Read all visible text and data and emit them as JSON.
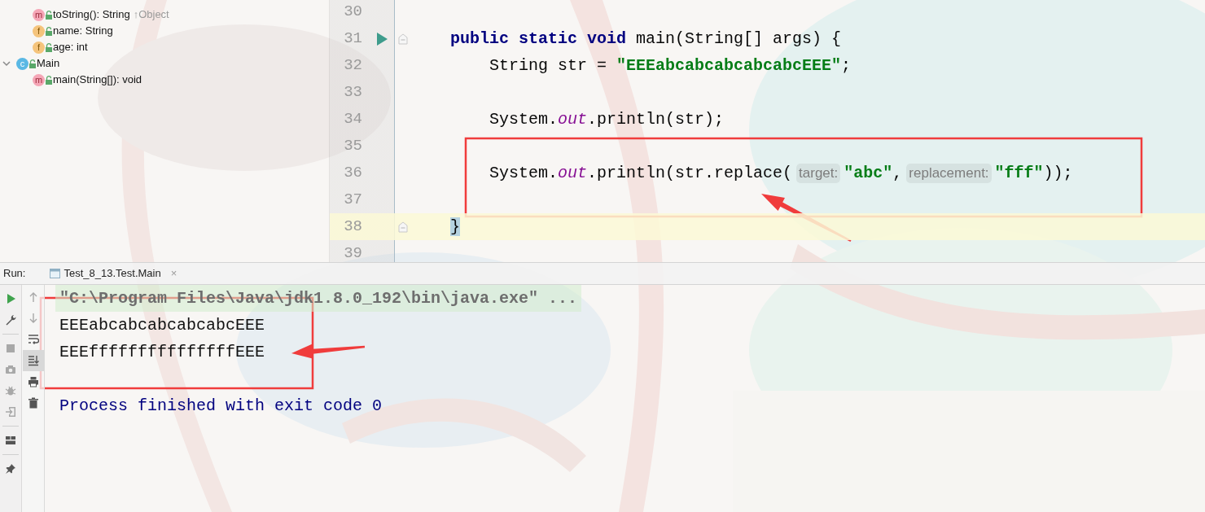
{
  "structure": {
    "tree": [
      {
        "children": [
          {
            "kind": "method",
            "icon": "m",
            "text": "toString(): String",
            "suffix": "↑Object"
          },
          {
            "kind": "field",
            "icon": "f",
            "text": "name: String"
          },
          {
            "kind": "field",
            "icon": "f",
            "text": "age: int"
          }
        ]
      },
      {
        "kind": "class",
        "icon": "c",
        "text": "Main",
        "expanded": true,
        "children": [
          {
            "kind": "method",
            "icon": "m",
            "text": "main(String[]): void"
          }
        ]
      }
    ]
  },
  "editor": {
    "lines": [
      {
        "number": "30"
      },
      {
        "number": "31",
        "kind": "member",
        "run_icon": true,
        "fold": true,
        "segments": [
          {
            "kind": "code",
            "parts": [
              {
                "kind": "keyword",
                "text": "public static void"
              },
              {
                "kind": "plain",
                "text": " main(String[] args) {"
              }
            ]
          }
        ]
      },
      {
        "number": "32",
        "kind": "statement",
        "segments": [
          {
            "kind": "code",
            "parts": [
              {
                "kind": "plain",
                "text": "String str = "
              },
              {
                "kind": "string",
                "text": "\"EEEabcabcabcabcabcEEE\""
              },
              {
                "kind": "plain",
                "text": ";"
              }
            ]
          }
        ]
      },
      {
        "number": "33"
      },
      {
        "number": "34",
        "kind": "statement",
        "segments": [
          {
            "kind": "code",
            "parts": [
              {
                "kind": "plain",
                "text": "System."
              },
              {
                "kind": "field",
                "text": "out"
              },
              {
                "kind": "plain",
                "text": ".println(str);"
              }
            ]
          }
        ]
      },
      {
        "number": "35"
      },
      {
        "number": "36",
        "kind": "statement",
        "segments": [
          {
            "kind": "code",
            "parts": [
              {
                "kind": "plain",
                "text": "System."
              },
              {
                "kind": "field",
                "text": "out"
              },
              {
                "kind": "plain",
                "text": ".println(str.replace("
              }
            ]
          },
          {
            "kind": "hint",
            "text": "target:"
          },
          {
            "kind": "code",
            "parts": [
              {
                "kind": "string",
                "text": "\"abc\""
              },
              {
                "kind": "plain",
                "text": ","
              }
            ]
          },
          {
            "kind": "hint",
            "text": "replacement:"
          },
          {
            "kind": "code",
            "parts": [
              {
                "kind": "string",
                "text": "\"fff\""
              },
              {
                "kind": "plain",
                "text": "));"
              }
            ]
          }
        ]
      },
      {
        "number": "37"
      },
      {
        "number": "38",
        "kind": "member",
        "current": true,
        "fold": true,
        "segments": [
          {
            "kind": "code",
            "parts": [
              {
                "kind": "brace",
                "text": "}"
              }
            ]
          }
        ]
      },
      {
        "number": "39"
      }
    ]
  },
  "run_panel": {
    "label": "Run:",
    "tabs": [
      {
        "title": "Test_8_13.Test.Main",
        "close": "×"
      }
    ],
    "run_toolbar": [
      {
        "kind": "run",
        "disabled": false
      },
      {
        "kind": "wrench",
        "disabled": false
      },
      {
        "kind": "divider"
      },
      {
        "kind": "stop",
        "disabled": true
      },
      {
        "kind": "camera",
        "disabled": true
      },
      {
        "kind": "bug",
        "disabled": true
      },
      {
        "kind": "exit",
        "disabled": true
      },
      {
        "kind": "divider"
      },
      {
        "kind": "layout",
        "disabled": false
      },
      {
        "kind": "divider"
      },
      {
        "kind": "pin",
        "disabled": false
      }
    ],
    "console_toolbar": [
      {
        "kind": "up",
        "on": false,
        "disabled": true
      },
      {
        "kind": "down",
        "on": false,
        "disabled": true
      },
      {
        "kind": "wrap",
        "on": false,
        "disabled": false
      },
      {
        "kind": "scroll-end",
        "on": true,
        "disabled": false
      },
      {
        "kind": "print",
        "on": false,
        "disabled": false
      },
      {
        "kind": "delete",
        "on": false,
        "disabled": false
      }
    ],
    "console": [
      {
        "kind": "command",
        "text": "\"C:\\Program Files\\Java\\jdk1.8.0_192\\bin\\java.exe\" ..."
      },
      {
        "kind": "output",
        "text": "EEEabcabcabcabcabcEEE"
      },
      {
        "kind": "output",
        "text": "EEEfffffffffffffffEEE"
      },
      {
        "kind": "system",
        "text": "Process finished with exit code 0"
      }
    ]
  }
}
